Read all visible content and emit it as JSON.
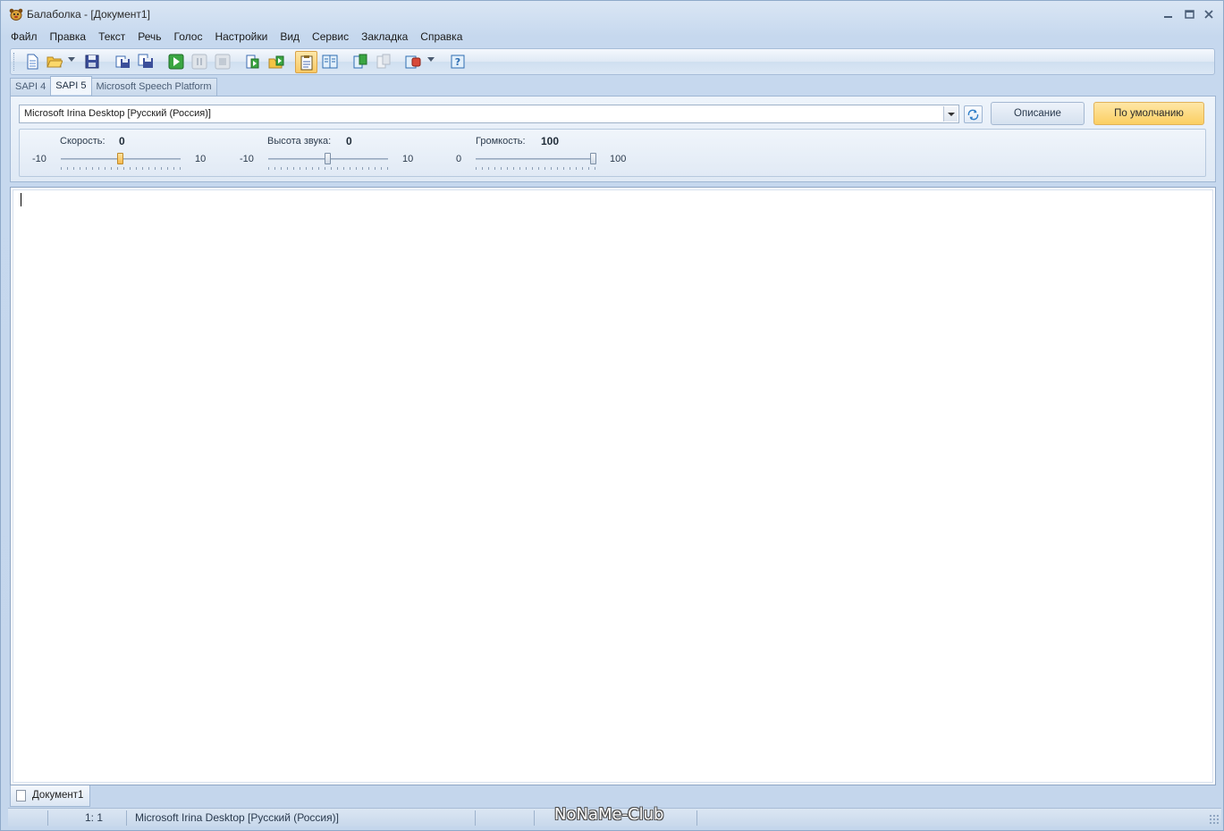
{
  "window": {
    "title": "Балаболка - [Документ1]"
  },
  "menu": [
    "Файл",
    "Правка",
    "Текст",
    "Речь",
    "Голос",
    "Настройки",
    "Вид",
    "Сервис",
    "Закладка",
    "Справка"
  ],
  "toolbar": {
    "icons": [
      "new-document-icon",
      "open-folder-icon",
      "save-icon",
      "export-audio-icon",
      "batch-convert-icon",
      "play-icon",
      "pause-icon",
      "stop-icon",
      "read-clipboard-icon",
      "read-file-icon",
      "clipboard-monitor-icon",
      "dictionary-icon",
      "split-icon",
      "merge-icon",
      "voice-select-icon",
      "help-icon"
    ]
  },
  "tabs": [
    "SAPI 4",
    "SAPI 5",
    "Microsoft Speech Platform"
  ],
  "active_tab": "SAPI 5",
  "voice": {
    "selected": "Microsoft Irina Desktop [Русский (Россия)]",
    "description_button": "Описание",
    "default_button": "По умолчанию"
  },
  "sliders": {
    "rate": {
      "label": "Скорость:",
      "value": "0",
      "min": "-10",
      "max": "10"
    },
    "pitch": {
      "label": "Высота звука:",
      "value": "0",
      "min": "-10",
      "max": "10"
    },
    "volume": {
      "label": "Громкость:",
      "value": "100",
      "min": "0",
      "max": "100"
    }
  },
  "editor": {
    "text": ""
  },
  "doc_tab": {
    "label": "Документ1"
  },
  "status": {
    "position": "1:   1",
    "voice": "Microsoft Irina Desktop [Русский (Россия)]"
  },
  "watermark": "NoNaMe-Club",
  "colors": {
    "accent": "#fbcf62",
    "frame": "#c4d6ec"
  }
}
